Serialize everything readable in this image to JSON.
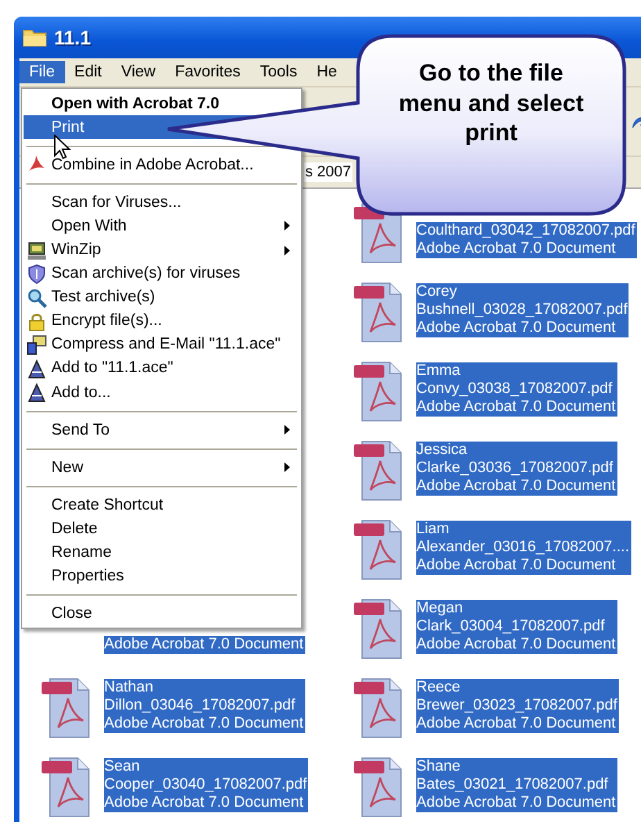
{
  "window": {
    "title": "11.1"
  },
  "menubar": [
    {
      "label": "File",
      "selected": true
    },
    {
      "label": "Edit",
      "selected": false
    },
    {
      "label": "View",
      "selected": false
    },
    {
      "label": "Favorites",
      "selected": false
    },
    {
      "label": "Tools",
      "selected": false
    },
    {
      "label": "He",
      "selected": false
    }
  ],
  "address": {
    "text": "s 2007"
  },
  "file_menu": [
    {
      "kind": "item",
      "label": "Open with Acrobat 7.0",
      "default": true,
      "selected": false,
      "submenu": false
    },
    {
      "kind": "item",
      "label": "Print",
      "default": false,
      "selected": true,
      "submenu": false
    },
    {
      "kind": "separator"
    },
    {
      "kind": "item",
      "label": "Combine in Adobe Acrobat...",
      "default": false,
      "selected": false,
      "submenu": false
    },
    {
      "kind": "separator"
    },
    {
      "kind": "item",
      "label": "Scan for Viruses...",
      "default": false,
      "selected": false,
      "submenu": false
    },
    {
      "kind": "item",
      "label": "Open With",
      "default": false,
      "selected": false,
      "submenu": true
    },
    {
      "kind": "item",
      "label": "WinZip",
      "default": false,
      "selected": false,
      "submenu": true
    },
    {
      "kind": "item",
      "label": "Scan archive(s) for viruses",
      "default": false,
      "selected": false,
      "submenu": false
    },
    {
      "kind": "item",
      "label": "Test archive(s)",
      "default": false,
      "selected": false,
      "submenu": false
    },
    {
      "kind": "item",
      "label": "Encrypt file(s)...",
      "default": false,
      "selected": false,
      "submenu": false
    },
    {
      "kind": "item",
      "label": "Compress and E-Mail \"11.1.ace\"",
      "default": false,
      "selected": false,
      "submenu": false
    },
    {
      "kind": "item",
      "label": "Add to \"11.1.ace\"",
      "default": false,
      "selected": false,
      "submenu": false
    },
    {
      "kind": "item",
      "label": "Add to...",
      "default": false,
      "selected": false,
      "submenu": false
    },
    {
      "kind": "separator"
    },
    {
      "kind": "item",
      "label": "Send To",
      "default": false,
      "selected": false,
      "submenu": true
    },
    {
      "kind": "separator"
    },
    {
      "kind": "item",
      "label": "New",
      "default": false,
      "selected": false,
      "submenu": true
    },
    {
      "kind": "separator"
    },
    {
      "kind": "item",
      "label": "Create Shortcut",
      "default": false,
      "selected": false,
      "submenu": false
    },
    {
      "kind": "item",
      "label": "Delete",
      "default": false,
      "selected": false,
      "submenu": false
    },
    {
      "kind": "item",
      "label": "Rename",
      "default": false,
      "selected": false,
      "submenu": false
    },
    {
      "kind": "item",
      "label": "Properties",
      "default": false,
      "selected": false,
      "submenu": false
    },
    {
      "kind": "separator"
    },
    {
      "kind": "item",
      "label": "Close",
      "default": false,
      "selected": false,
      "submenu": false
    }
  ],
  "callout": {
    "text": "Go to the file menu and select print"
  },
  "file_rows": [
    {
      "right": {
        "name_lines": [
          "Coulthard_03042_17082007.pdf"
        ],
        "type": "Adobe Acrobat 7.0 Document",
        "selected": true
      }
    },
    {
      "right": {
        "name_lines": [
          "Corey",
          "Bushnell_03028_17082007.pdf"
        ],
        "type": "Adobe Acrobat 7.0 Document",
        "selected": true
      }
    },
    {
      "right": {
        "name_lines": [
          "Emma",
          "Convy_03038_17082007.pdf"
        ],
        "type": "Adobe Acrobat 7.0 Document",
        "selected": true
      }
    },
    {
      "right": {
        "name_lines": [
          "Jessica",
          "Clarke_03036_17082007.pdf"
        ],
        "type": "Adobe Acrobat 7.0 Document",
        "selected": true
      }
    },
    {
      "right": {
        "name_lines": [
          "Liam",
          "Alexander_03016_17082007...."
        ],
        "type": "Adobe Acrobat 7.0 Document",
        "selected": true
      }
    },
    {
      "left": {
        "type": "Adobe Acrobat 7.0 Document",
        "selected": true
      },
      "right": {
        "name_lines": [
          "Megan",
          "Clark_03004_17082007.pdf"
        ],
        "type": "Adobe Acrobat 7.0 Document",
        "selected": true
      }
    },
    {
      "left": {
        "name_lines": [
          "Nathan",
          "Dillon_03046_17082007.pdf"
        ],
        "type": "Adobe Acrobat 7.0 Document",
        "selected": true
      },
      "right": {
        "name_lines": [
          "Reece",
          "Brewer_03023_17082007.pdf"
        ],
        "type": "Adobe Acrobat 7.0 Document",
        "selected": true
      }
    },
    {
      "left": {
        "name_lines": [
          "Sean",
          "Cooper_03040_17082007.pdf"
        ],
        "type": "Adobe Acrobat 7.0 Document",
        "selected": true
      },
      "right": {
        "name_lines": [
          "Shane",
          "Bates_03021_17082007.pdf"
        ],
        "type": "Adobe Acrobat 7.0 Document",
        "selected": true
      }
    }
  ]
}
